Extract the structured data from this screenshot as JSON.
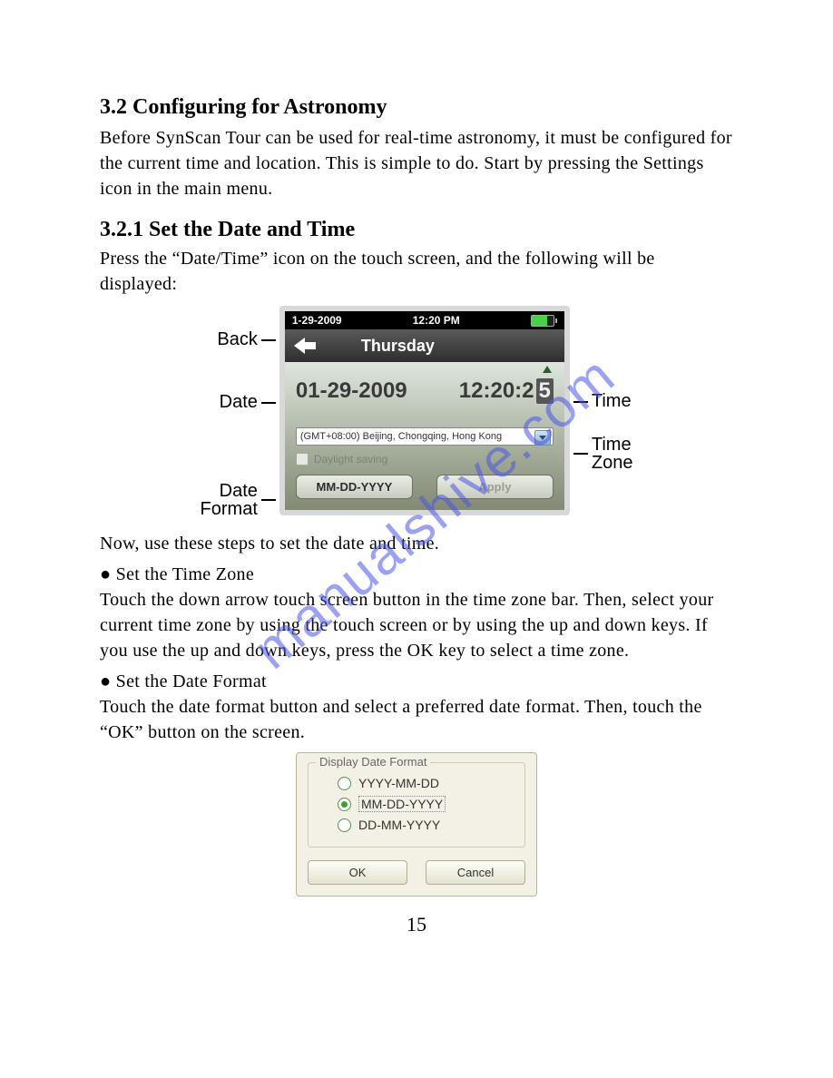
{
  "section": {
    "num_title": "3.2  Configuring for Astronomy",
    "intro": "Before SynScan Tour can be used for real-time astronomy, it must be configured for the current time and location. This is simple to do. Start by pressing the Settings icon in the main menu.",
    "sub_title": "3.2.1  Set the Date and Time",
    "sub_intro": "Press the “Date/Time” icon on the touch screen, and the following will be displayed:"
  },
  "fig1": {
    "callouts": {
      "back": "Back",
      "date": "Date",
      "format": "Date\nFormat",
      "time": "Time",
      "zone": "Time\nZone"
    },
    "statusbar": {
      "date": "1-29-2009",
      "clock": "12:20 PM"
    },
    "titlebar": "Thursday",
    "date_value": "01-29-2009",
    "time_hm": "12:20:2",
    "time_sec": "5",
    "timezone": "(GMT+08:00) Beijing, Chongqing, Hong Kong",
    "dst_label": "Daylight saving",
    "format_btn": "MM-DD-YYYY",
    "apply_btn": "Apply"
  },
  "steps": {
    "lead": "Now, use these steps to set the date and time.",
    "bullet1": "● Set the Time Zone",
    "para1": "Touch the down arrow touch screen button in the time zone bar. Then, select your current time zone by using the touch screen or by using the up and down keys. If you use the up and down keys, press the OK key to select a time zone.",
    "bullet2": "● Set the Date Format",
    "para2": "Touch the date format button and select a preferred date format. Then, touch the “OK” button on the screen."
  },
  "fig2": {
    "group_title": "Display Date Format",
    "options": [
      "YYYY-MM-DD",
      "MM-DD-YYYY",
      "DD-MM-YYYY"
    ],
    "selected_index": 1,
    "ok": "OK",
    "cancel": "Cancel"
  },
  "page_number": "15",
  "watermark": "manualshive.com"
}
